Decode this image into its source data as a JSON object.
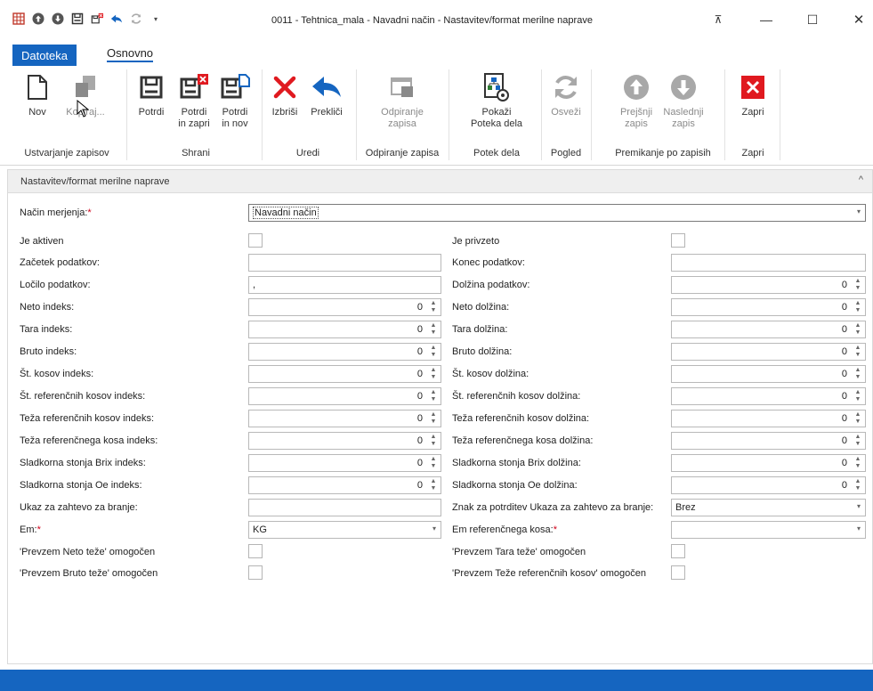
{
  "window": {
    "title": "0011 - Tehtnica_mala - Navadni način - Nastavitev/format merilne naprave",
    "minimize": "—",
    "maximize": "☐",
    "close": "✕",
    "restore_icon": "⊼"
  },
  "qat": [
    "grid-icon",
    "up-circle-icon",
    "down-circle-icon",
    "save-icon",
    "save-close-icon",
    "undo-icon",
    "refresh-icon",
    "dropdown-icon"
  ],
  "tabs": {
    "file": "Datoteka",
    "home": "Osnovno"
  },
  "ribbon": {
    "groups": {
      "create": "Ustvarjanje zapisov",
      "save": "Shrani",
      "edit": "Uredi",
      "open": "Odpiranje zapisa",
      "flow": "Potek dela",
      "view": "Pogled",
      "nav": "Premikanje po zapisih",
      "close": "Zapri"
    },
    "buttons": {
      "new": "Nov",
      "copy": "Kopiraj...",
      "confirm": "Potrdi",
      "confirm_close_1": "Potrdi",
      "confirm_close_2": "in zapri",
      "confirm_new_1": "Potrdi",
      "confirm_new_2": "in nov",
      "delete": "Izbriši",
      "cancel": "Prekliči",
      "open_1": "Odpiranje",
      "open_2": "zapisa",
      "flow_1": "Pokaži",
      "flow_2": "Poteka dela",
      "refresh": "Osveži",
      "prev_1": "Prejšnji",
      "prev_2": "zapis",
      "next_1": "Naslednji",
      "next_2": "zapis",
      "close": "Zapri"
    },
    "colors": {
      "accent": "#1565c0",
      "delete": "#e0191f",
      "close_bg": "#e0191f",
      "disabled": "#a8a8a8"
    }
  },
  "panel": {
    "title": "Nastavitev/format merilne naprave",
    "collapse": "^",
    "method_label": "Način merjenja:",
    "method_value": "Navadni način",
    "left": [
      {
        "label": "Je aktiven"
      },
      {
        "label": "Začetek podatkov:",
        "value": ""
      },
      {
        "label": "Ločilo podatkov:",
        "value": ","
      },
      {
        "label": "Neto indeks:",
        "value": "0"
      },
      {
        "label": "Tara indeks:",
        "value": "0"
      },
      {
        "label": "Bruto indeks:",
        "value": "0"
      },
      {
        "label": "Št. kosov indeks:",
        "value": "0"
      },
      {
        "label": "Št. referenčnih kosov indeks:",
        "value": "0"
      },
      {
        "label": "Teža referenčnih kosov indeks:",
        "value": "0"
      },
      {
        "label": "Teža referenčnega kosa indeks:",
        "value": "0"
      },
      {
        "label": "Sladkorna stonja Brix indeks:",
        "value": "0"
      },
      {
        "label": "Sladkorna stonja Oe indeks:",
        "value": "0"
      },
      {
        "label": "Ukaz za zahtevo za branje:",
        "value": ""
      },
      {
        "label": "Em:",
        "value": "KG"
      },
      {
        "label": "'Prevzem Neto teže' omogočen"
      },
      {
        "label": "'Prevzem Bruto teže' omogočen"
      }
    ],
    "right": [
      {
        "label": "Je privzeto"
      },
      {
        "label": "Konec podatkov:",
        "value": ""
      },
      {
        "label": "Dolžina podatkov:",
        "value": "0"
      },
      {
        "label": "Neto dolžina:",
        "value": "0"
      },
      {
        "label": "Tara dolžina:",
        "value": "0"
      },
      {
        "label": "Bruto dolžina:",
        "value": "0"
      },
      {
        "label": "Št. kosov dolžina:",
        "value": "0"
      },
      {
        "label": "Št. referenčnih kosov dolžina:",
        "value": "0"
      },
      {
        "label": "Teža referenčnih kosov dolžina:",
        "value": "0"
      },
      {
        "label": "Teža referenčnega kosa dolžina:",
        "value": "0"
      },
      {
        "label": "Sladkorna stonja Brix dolžina:",
        "value": "0"
      },
      {
        "label": "Sladkorna stonja Oe dolžina:",
        "value": "0"
      },
      {
        "label": "Znak za potrditev Ukaza za zahtevo za branje:",
        "value": "Brez"
      },
      {
        "label": "Em referenčnega kosa:",
        "value": ""
      },
      {
        "label": "'Prevzem Tara teže' omogočen"
      },
      {
        "label": "'Prevzem Teže referenčnih kosov' omogočen"
      }
    ],
    "required_mark": "*"
  }
}
